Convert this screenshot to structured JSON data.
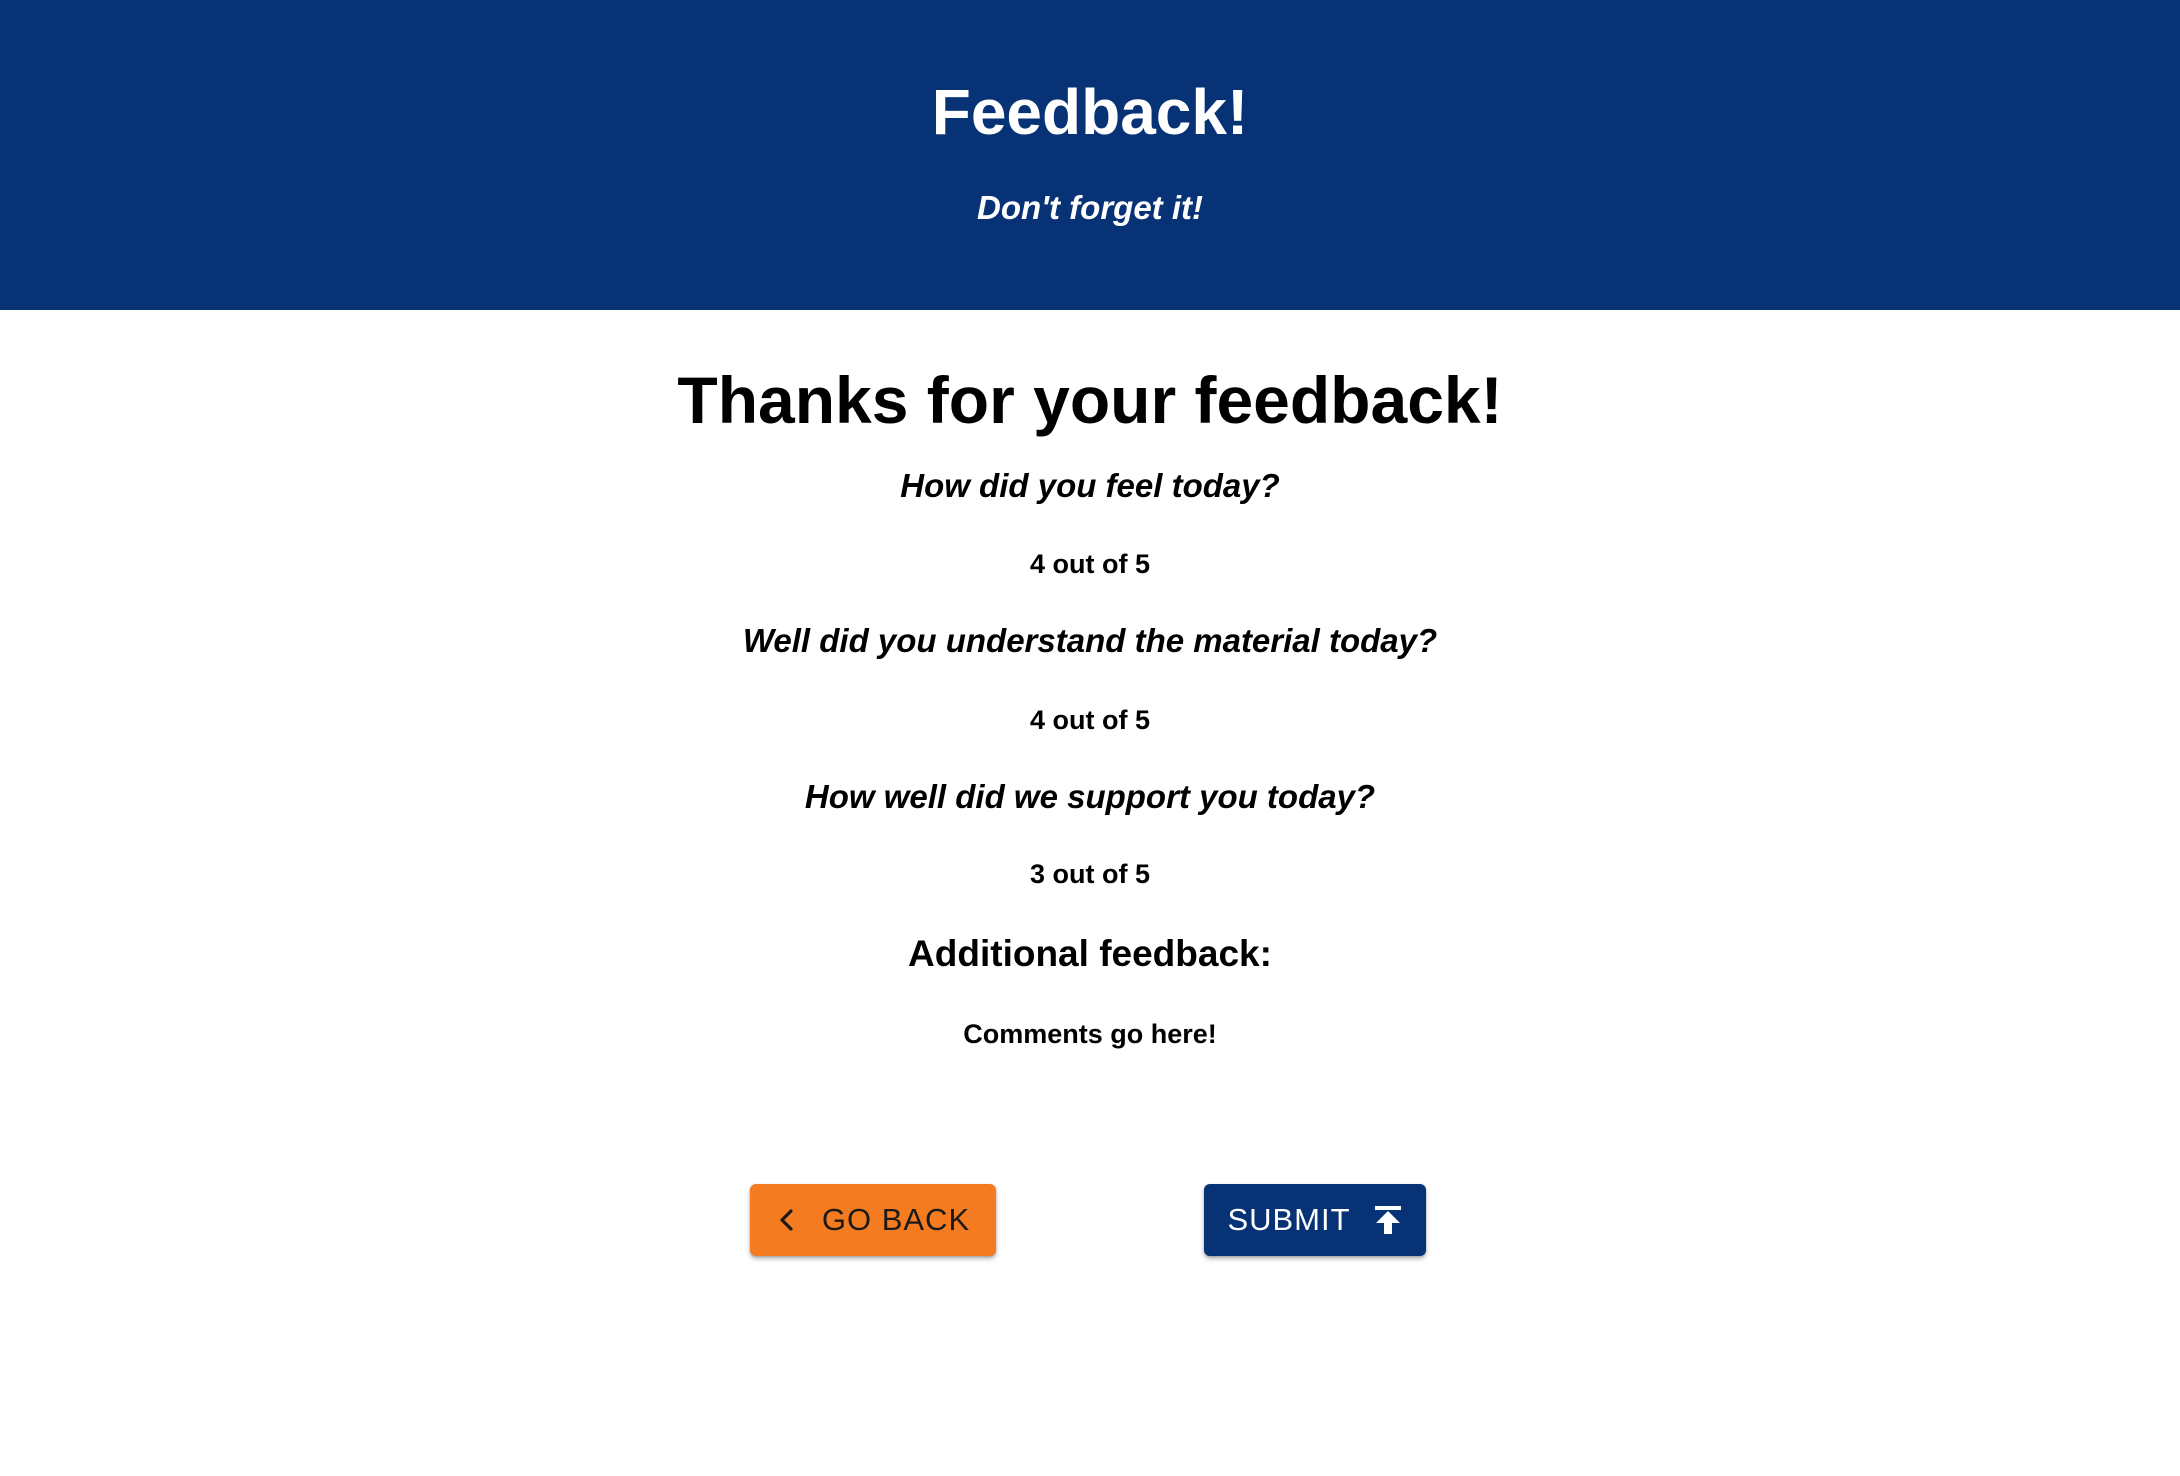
{
  "header": {
    "title": "Feedback!",
    "subtitle": "Don't forget it!",
    "background_color": "#083276"
  },
  "main": {
    "title": "Thanks for your feedback!",
    "questions": [
      {
        "question": "How did you feel today?",
        "answer": "4 out of 5"
      },
      {
        "question": "Well did you understand the material today?",
        "answer": "4 out of 5"
      },
      {
        "question": "How well did we support you today?",
        "answer": "3 out of 5"
      }
    ],
    "additional_heading": "Additional feedback:",
    "additional_text": "Comments go here!"
  },
  "actions": {
    "back_label": "GO BACK",
    "back_icon": "chevron-left-icon",
    "back_color": "#f47b20",
    "submit_label": "SUBMIT",
    "submit_icon": "upload-arrow-icon",
    "submit_color": "#083276"
  }
}
